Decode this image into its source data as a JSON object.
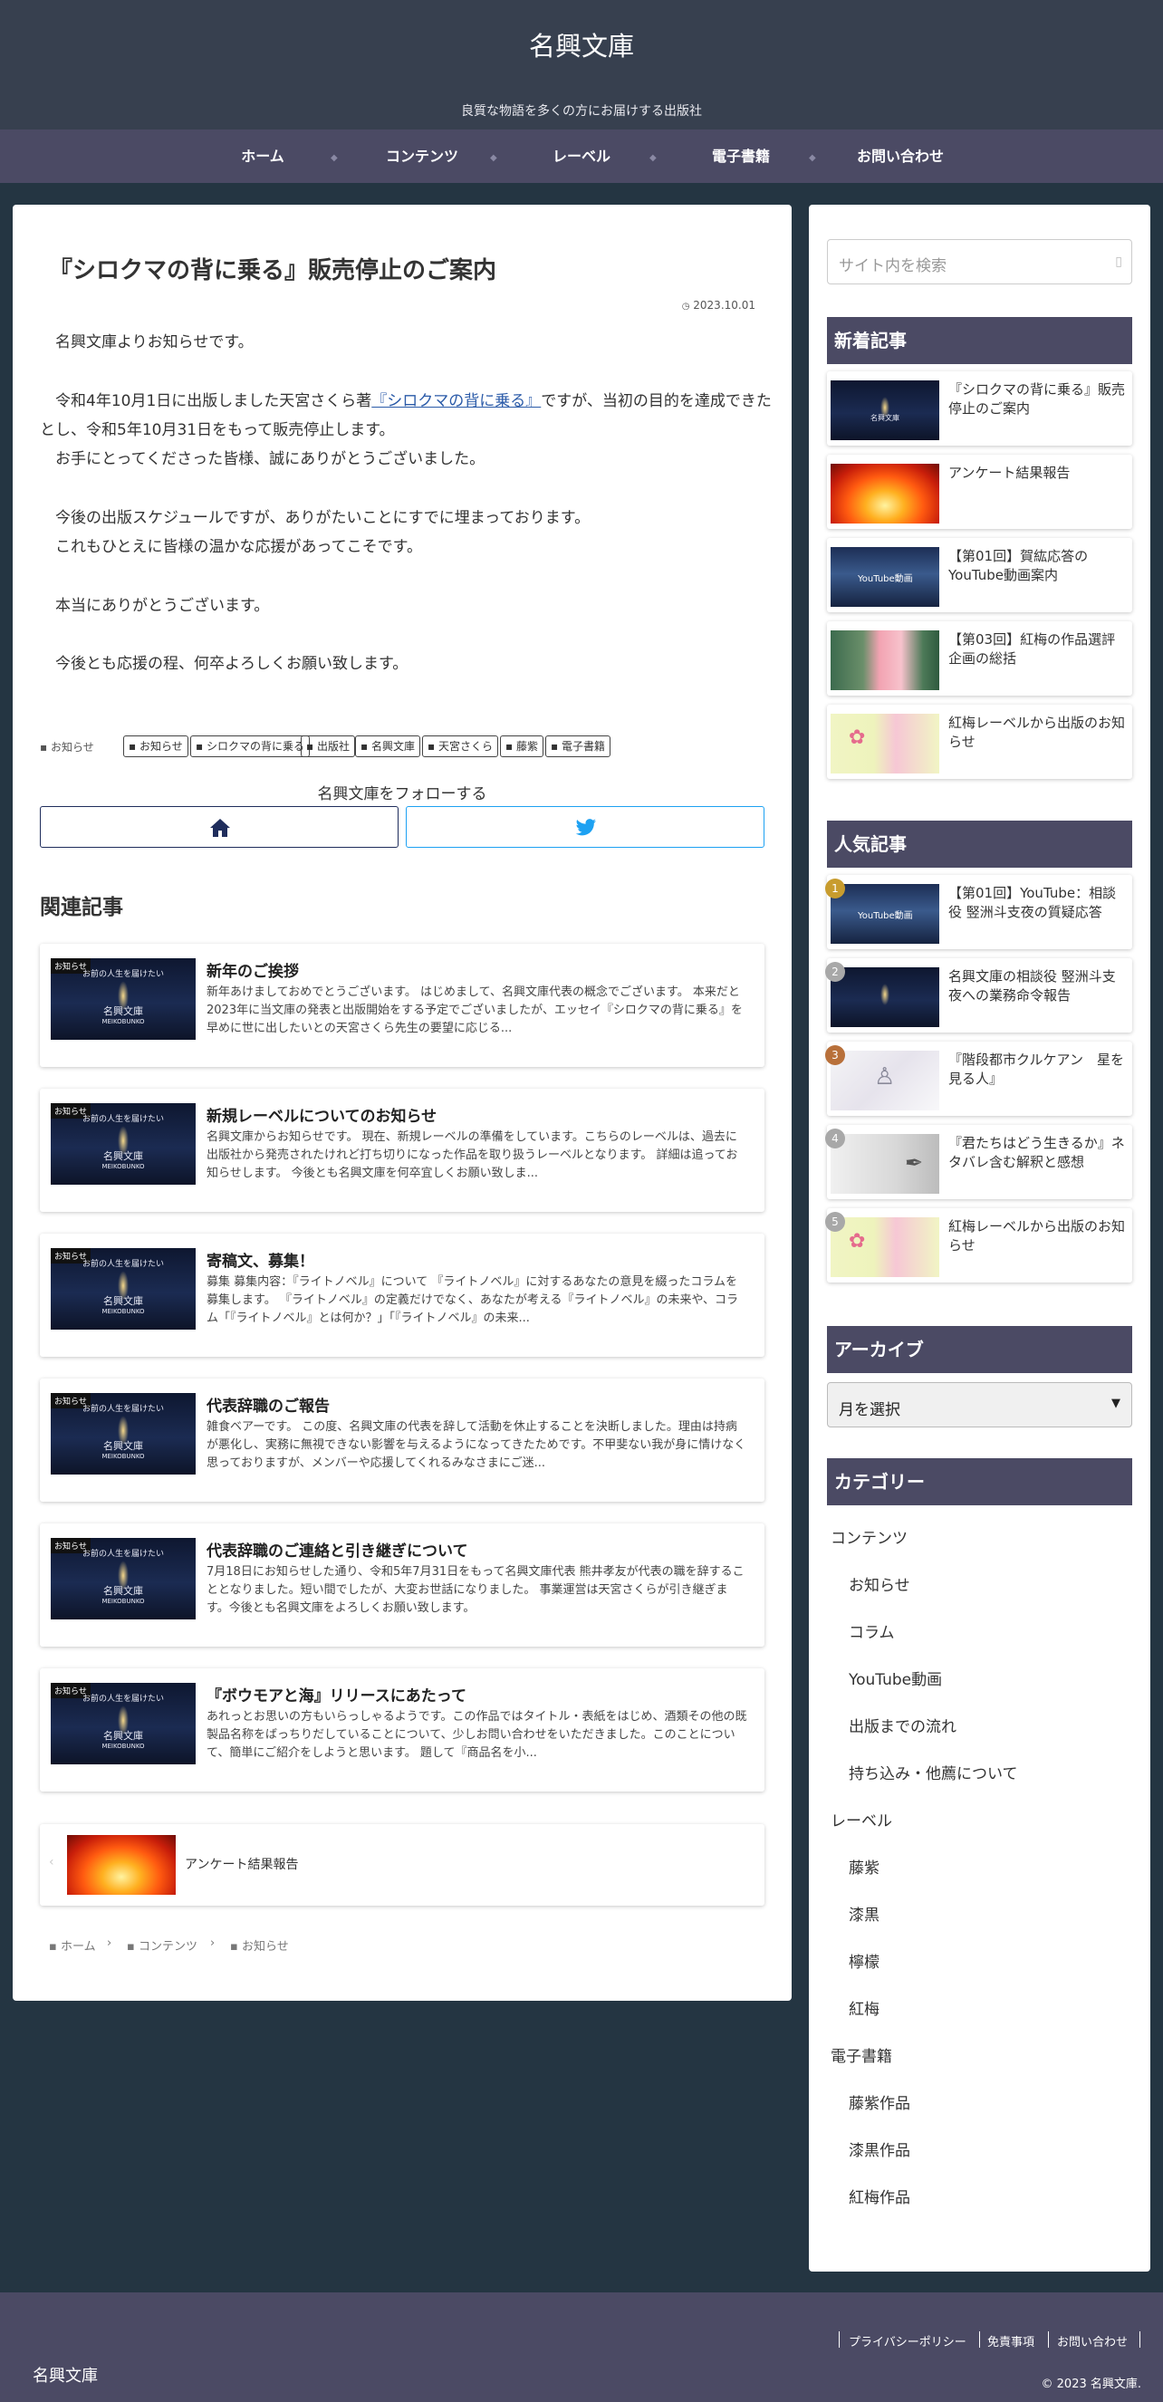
{
  "site": {
    "title": "名興文庫",
    "tagline": "良質な物語を多くの方にお届けする出版社"
  },
  "nav": [
    "ホーム",
    "コンテンツ",
    "レーベル",
    "電子書籍",
    "お問い合わせ"
  ],
  "article": {
    "title": "『シロクマの背に乗る』販売停止のご案内",
    "date": "2023.10.01",
    "p1": "名興文庫よりお知らせです。",
    "p2a": "令和4年10月1日に出版しました天宮さくら著",
    "p2link": "『シロクマの背に乗る』",
    "p2b": "ですが、当初の目的を達成できたとし、令和5年10月31日をもって販売停止します。",
    "p3": "お手にとってくださった皆様、誠にありがとうございました。",
    "p4": "今後の出版スケジュールですが、ありがたいことにすでに埋まっております。",
    "p5": "これもひとえに皆様の温かな応援があってこそです。",
    "p6": "本当にありがとうございます。",
    "p7": "今後とも応援の程、何卒よろしくお願い致します。"
  },
  "category_label": "お知らせ",
  "tags": [
    "お知らせ",
    "シロクマの背に乗る",
    "出版社",
    "名興文庫",
    "天宮さくら",
    "藤紫",
    "電子書籍"
  ],
  "follow": {
    "title": "名興文庫をフォローする"
  },
  "related": {
    "heading": "関連記事",
    "items": [
      {
        "badge": "お知らせ",
        "title": "新年のご挨拶",
        "excerpt": "新年あけましておめでとうございます。 はじめまして、名興文庫代表の概念でございます。 本来だと2023年に当文庫の発表と出版開始をする予定でございましたが、エッセイ『シロクマの背に乗る』を早めに世に出したいとの天宮さくら先生の要望に応じる..."
      },
      {
        "badge": "お知らせ",
        "title": "新規レーベルについてのお知らせ",
        "excerpt": "名興文庫からお知らせです。 現在、新規レーベルの準備をしています。こちらのレーベルは、過去に出版社から発売されたけれど打ち切りになった作品を取り扱うレーベルとなります。 詳細は追ってお知らせします。 今後とも名興文庫を何卒宜しくお願い致しま..."
      },
      {
        "badge": "お知らせ",
        "title": "寄稿文、募集！",
        "excerpt": "募集 募集内容：『ライトノベル』について 『ライトノベル』に対するあなたの意見を綴ったコラムを募集します。 『ライトノベル』の定義だけでなく、あなたが考える『ライトノベル』の未来や、コラム「『ライトノベル』とは何か？」「『ライトノベル』の未来..."
      },
      {
        "badge": "お知らせ",
        "title": "代表辞職のご報告",
        "excerpt": "雑食ベアーです。 この度、名興文庫の代表を辞して活動を休止することを決断しました。理由は持病が悪化し、実務に無視できない影響を与えるようになってきたためです。不甲斐ない我が身に情けなく思っておりますが、メンバーや応援してくれるみなさまにご迷..."
      },
      {
        "badge": "お知らせ",
        "title": "代表辞職のご連絡と引き継ぎについて",
        "excerpt": "7月18日にお知らせした通り、令和5年7月31日をもって名興文庫代表 熊井孝友が代表の職を辞することとなりました。短い間でしたが、大変お世話になりました。 事業運営は天宮さくらが引き継ぎます。今後とも名興文庫をよろしくお願い致します。"
      },
      {
        "badge": "お知らせ",
        "title": "『ボウモアと海』リリースにあたって",
        "excerpt": "あれっとお思いの方もいらっしゃるようです。この作品ではタイトル・表紙をはじめ、酒類その他の既製品名称をばっちりだしていることについて、少しお問い合わせをいただきました。このことについて、簡単にご紹介をしようと思います。 題して『商品名を小..."
      }
    ],
    "thumb_text": {
      "top": "お前の人生を届けたい",
      "name": "名興文庫",
      "sub": "MEIKOBUNKO"
    }
  },
  "next_post": {
    "title": "アンケート結果報告"
  },
  "breadcrumb": [
    "ホーム",
    "コンテンツ",
    "お知らせ"
  ],
  "sidebar": {
    "search_placeholder": "サイト内を検索",
    "new_title": "新着記事",
    "new_items": [
      {
        "title": "『シロクマの背に乗る』販売停止のご案内",
        "thumb": "navy"
      },
      {
        "title": "アンケート結果報告",
        "thumb": "fire"
      },
      {
        "title": "【第01回】賀紘応答のYouTube動画案内",
        "thumb": "youtube"
      },
      {
        "title": "【第03回】紅梅の作品選評企画の総括",
        "thumb": "pink"
      },
      {
        "title": "紅梅レーベルから出版のお知らせ",
        "thumb": "plum"
      }
    ],
    "popular_title": "人気記事",
    "popular_items": [
      {
        "rank": "1",
        "title": "【第01回】YouTube：相談役 竪洲斗支夜の質疑応答",
        "thumb": "youtube"
      },
      {
        "rank": "2",
        "title": "名興文庫の相談役 竪洲斗支夜への業務命令報告",
        "thumb": "navy"
      },
      {
        "rank": "3",
        "title": "『階段都市クルケアン　星を見る人』",
        "thumb": "white"
      },
      {
        "rank": "4",
        "title": "『君たちはどう生きるか』ネタバレ含む解釈と感想",
        "thumb": "gray"
      },
      {
        "rank": "5",
        "title": "紅梅レーベルから出版のお知らせ",
        "thumb": "plum"
      }
    ],
    "archive_title": "アーカイブ",
    "archive_select": "月を選択",
    "category_title": "カテゴリー",
    "categories": [
      {
        "name": "コンテンツ",
        "level": 0
      },
      {
        "name": "お知らせ",
        "level": 1
      },
      {
        "name": "コラム",
        "level": 1
      },
      {
        "name": "YouTube動画",
        "level": 1
      },
      {
        "name": "出版までの流れ",
        "level": 1
      },
      {
        "name": "持ち込み・他薦について",
        "level": 1
      },
      {
        "name": "レーベル",
        "level": 0
      },
      {
        "name": "藤紫",
        "level": 1
      },
      {
        "name": "漆黒",
        "level": 1
      },
      {
        "name": "檸檬",
        "level": 1
      },
      {
        "name": "紅梅",
        "level": 1
      },
      {
        "name": "電子書籍",
        "level": 0
      },
      {
        "name": "藤紫作品",
        "level": 1
      },
      {
        "name": "漆黒作品",
        "level": 1
      },
      {
        "name": "紅梅作品",
        "level": 1
      }
    ]
  },
  "footer": {
    "links": [
      "プライバシーポリシー",
      "免責事項",
      "お問い合わせ"
    ],
    "logo": "名興文庫",
    "copyright": "© 2023 名興文庫."
  },
  "colors": {
    "header": "#37404f",
    "nav": "#4b4a64",
    "background": "#243542",
    "twitter": "#1da1f2",
    "home_button": "#1f2d5c"
  }
}
